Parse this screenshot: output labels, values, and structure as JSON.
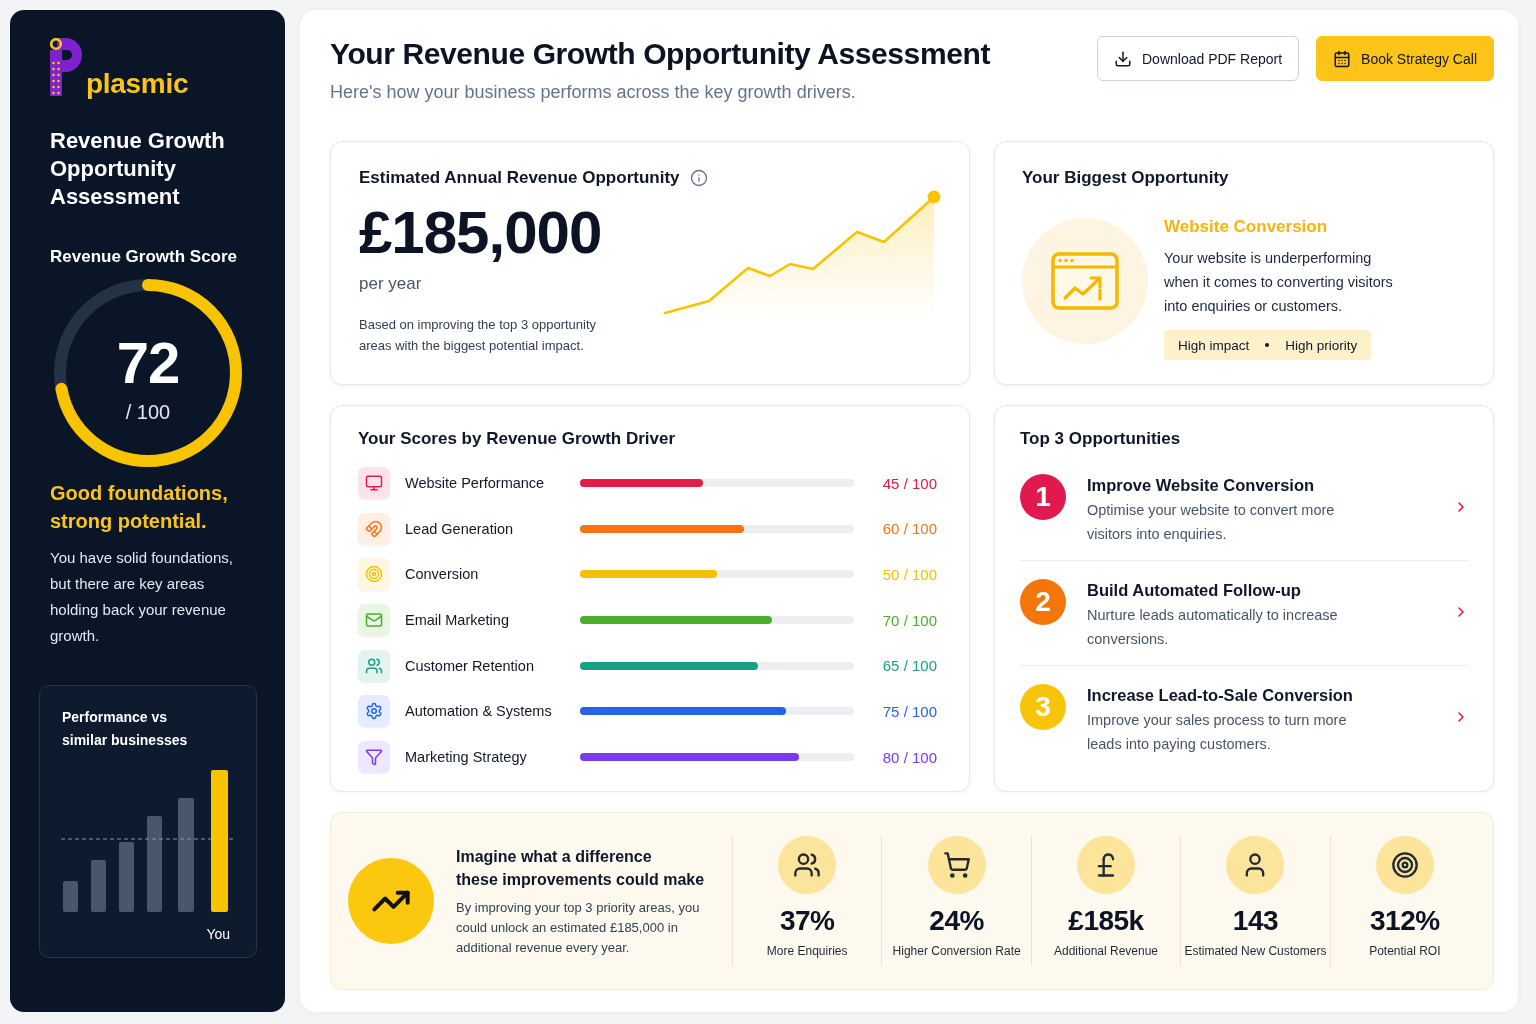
{
  "sidebar": {
    "logo": {
      "text": "plasmic"
    },
    "title": "Revenue Growth Opportunity Assessment",
    "score": {
      "label": "Revenue Growth Score",
      "value": "72",
      "max": "/ 100",
      "level": 0.72
    },
    "headline": "Good foundations, strong potential.",
    "summary": "You have solid foundations, but there are key areas holding back your revenue growth.",
    "comparison": {
      "title": "Performance vs similar businesses",
      "highlight_label": "You"
    }
  },
  "header": {
    "title": "Your Revenue Growth Opportunity Assessment",
    "subtitle": "Here's how your business performs across the key growth drivers.",
    "buttons": [
      {
        "label": "Download PDF Report",
        "kind": "outline"
      },
      {
        "label": "Book Strategy Call",
        "kind": "primary"
      }
    ]
  },
  "revenue_opportunity": {
    "title": "Estimated Annual Revenue Opportunity",
    "amount": "£185,000",
    "period": "per year",
    "note": "Based on improving the top 3 opportunity areas with the biggest potential impact."
  },
  "biggest_opportunity": {
    "title": "Your Biggest Opportunity",
    "name": "Website Conversion",
    "description": "Your website is underperforming when it comes to converting visitors into enquiries or customers.",
    "tags": [
      "High impact",
      "High priority"
    ]
  },
  "driver_scores": {
    "title": "Your Scores by Revenue Growth Driver",
    "drivers": [
      {
        "name": "Website Performance",
        "score": "45 / 100",
        "level": 0.45,
        "color": "#e11d48"
      },
      {
        "name": "Lead Generation",
        "score": "60 / 100",
        "level": 0.6,
        "color": "#f97316"
      },
      {
        "name": "Conversion",
        "score": "50 / 100",
        "level": 0.5,
        "color": "#f5c000"
      },
      {
        "name": "Email Marketing",
        "score": "70 / 100",
        "level": 0.7,
        "color": "#4caf2a"
      },
      {
        "name": "Customer Retention",
        "score": "65 / 100",
        "level": 0.65,
        "color": "#16a085"
      },
      {
        "name": "Automation & Systems",
        "score": "75 / 100",
        "level": 0.75,
        "color": "#2563eb"
      },
      {
        "name": "Marketing Strategy",
        "score": "80 / 100",
        "level": 0.8,
        "color": "#7c3aed"
      }
    ]
  },
  "top_opportunities": {
    "title": "Top 3 Opportunities",
    "items": [
      {
        "number": "1",
        "title": "Improve Website Conversion",
        "description": "Optimise your website to convert more visitors into enquiries.",
        "color": "#e0194f"
      },
      {
        "number": "2",
        "title": "Build Automated Follow-up",
        "description": "Nurture leads automatically to increase conversions.",
        "color": "#f4760b"
      },
      {
        "number": "3",
        "title": "Increase Lead-to-Sale Conversion",
        "description": "Improve your sales process to turn more leads into paying customers.",
        "color": "#f8c40a"
      }
    ]
  },
  "impact": {
    "heading": "Imagine what a difference\nthese improvements could make",
    "text": "By improving your top 3 priority areas, you could unlock an estimated £185,000 in additional revenue every year.",
    "stats": [
      {
        "value": "37%",
        "label": "More Enquiries"
      },
      {
        "value": "24%",
        "label": "Higher Conversion Rate"
      },
      {
        "value": "£185k",
        "label": "Additional Revenue"
      },
      {
        "value": "143",
        "label": "Estimated New Customers"
      },
      {
        "value": "312%",
        "label": "Potential ROI"
      }
    ]
  }
}
